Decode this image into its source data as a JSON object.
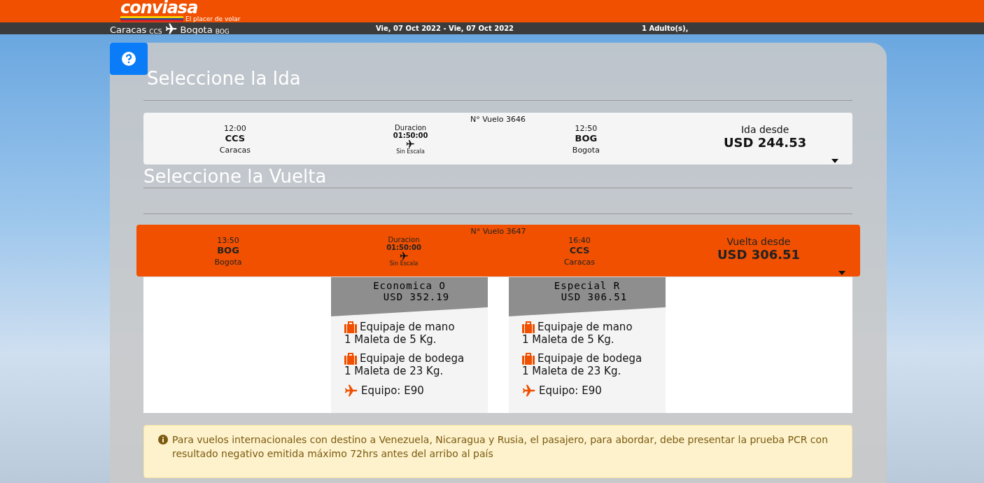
{
  "header": {
    "logo": "conviasa",
    "tagline": "El placer de volar"
  },
  "trip_bar": {
    "origin": "Caracas",
    "origin_code": "CCS",
    "destination": "Bogota",
    "destination_code": "BOG",
    "dates": "Vie, 07 Oct 2022 - Vie, 07 Oct 2022",
    "passengers": "1 Adulto(s),"
  },
  "sections": [
    {
      "title": "Seleccione la Ida",
      "flight": {
        "number": "N° Vuelo 3646",
        "selected": false,
        "depart_time": "12:00",
        "depart_code": "CCS",
        "depart_city": "Caracas",
        "duration_label": "Duracion",
        "duration": "01:50:00",
        "stops": "Sin Escala",
        "arrive_time": "12:50",
        "arrive_code": "BOG",
        "arrive_city": "Bogota",
        "price_label": "Ida desde",
        "price": "USD 244.53"
      }
    },
    {
      "title": "Seleccione la Vuelta",
      "flight": {
        "number": "N° Vuelo 3647",
        "selected": true,
        "depart_time": "13:50",
        "depart_code": "BOG",
        "depart_city": "Bogota",
        "duration_label": "Duracion",
        "duration": "01:50:00",
        "stops": "Sin Escala",
        "arrive_time": "16:40",
        "arrive_code": "CCS",
        "arrive_city": "Caracas",
        "price_label": "Vuelta desde",
        "price": "USD 306.51"
      },
      "fares": [
        {
          "name": "Economica O",
          "price": "USD 352.19",
          "items": [
            {
              "kind": "bag",
              "title": "Equipaje de mano",
              "detail": "1 Maleta de 5 Kg."
            },
            {
              "kind": "bag",
              "title": "Equipaje de bodega",
              "detail": "1 Maleta de 23 Kg."
            },
            {
              "kind": "plane",
              "title": "Equipo: E90"
            }
          ]
        },
        {
          "name": "Especial R",
          "price": "USD 306.51",
          "items": [
            {
              "kind": "bag",
              "title": "Equipaje de mano",
              "detail": "1 Maleta de 5 Kg."
            },
            {
              "kind": "bag",
              "title": "Equipaje de bodega",
              "detail": "1 Maleta de 23 Kg."
            },
            {
              "kind": "plane",
              "title": "Equipo: E90"
            }
          ]
        }
      ]
    }
  ],
  "notice": "Para vuelos internacionales con destino a Venezuela, Nicaragua y Rusia, el pasajero, para abordar, debe presentar la prueba PCR con resultado negativo emitida máximo 72hrs antes del arribo al país"
}
